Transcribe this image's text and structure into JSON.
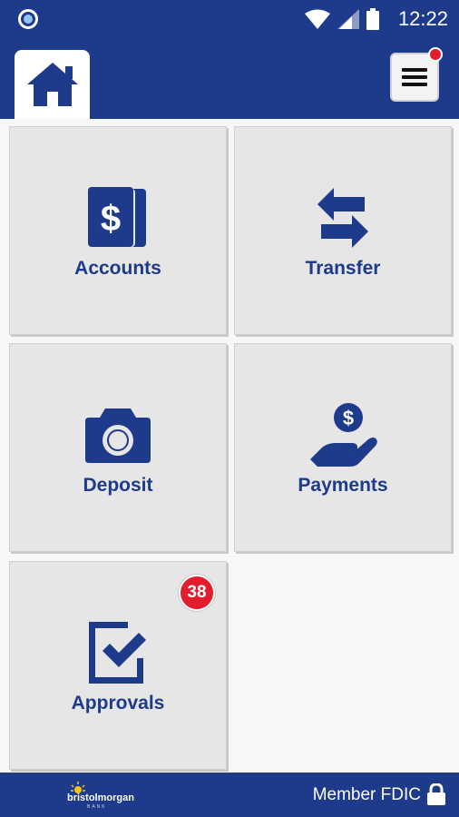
{
  "status_bar": {
    "time": "12:22"
  },
  "header": {
    "home_icon": "home-icon",
    "menu_icon": "hamburger-menu-icon"
  },
  "tiles": [
    {
      "label": "Accounts",
      "icon": "dollar-cards-icon"
    },
    {
      "label": "Transfer",
      "icon": "transfer-arrows-icon"
    },
    {
      "label": "Deposit",
      "icon": "camera-icon"
    },
    {
      "label": "Payments",
      "icon": "hand-coin-icon"
    },
    {
      "label": "Approvals",
      "icon": "checkbox-icon",
      "badge": "38"
    }
  ],
  "footer": {
    "logo_text": "bristolmorgan",
    "logo_sub": "BANK",
    "member_text": "Member FDIC"
  },
  "colors": {
    "brand": "#1e3a8a",
    "badge": "#e11d2e",
    "tile": "#e6e6e6"
  }
}
